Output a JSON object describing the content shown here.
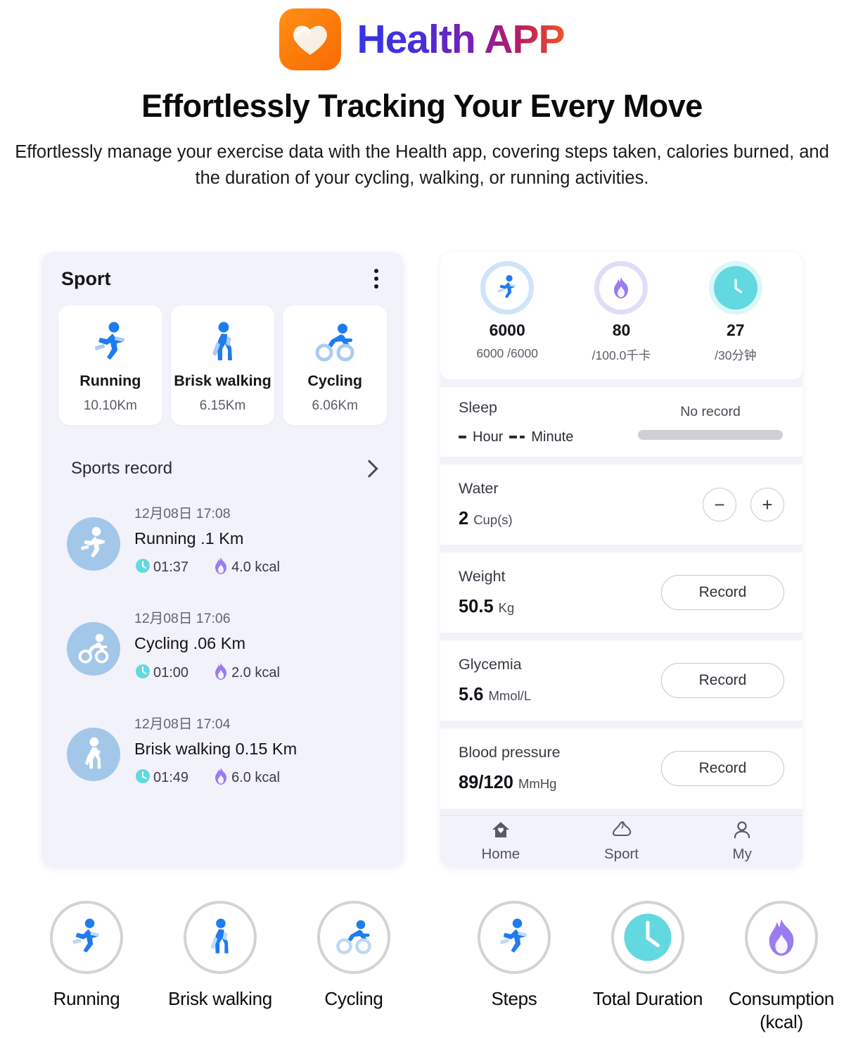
{
  "header": {
    "logo_icon": "heart-icon",
    "brand_name": "Health APP",
    "headline": "Effortlessly Tracking Your Every Move",
    "subheadline": "Effortlessly manage your exercise data with the Health app, covering steps taken, calories burned, and the duration of your cycling, walking, or running activities."
  },
  "colors": {
    "brand_orange": "#fb7a09",
    "brand_blue": "#3434e8",
    "brand_red": "#ef5422",
    "sport_blue": "#1f7ced",
    "avatar_blue": "#a3c7e8",
    "clock_cyan": "#62d9e0",
    "flame_purple": "#9b7cf0",
    "panel_bg": "#f2f2fa"
  },
  "sport_panel": {
    "title": "Sport",
    "menu_icon": "kebab-menu-icon",
    "cards": [
      {
        "icon": "running-icon",
        "name": "Running",
        "distance": "10.10Km"
      },
      {
        "icon": "walking-icon",
        "name": "Brisk walking",
        "distance": "6.15Km"
      },
      {
        "icon": "cycling-icon",
        "name": "Cycling",
        "distance": "6.06Km"
      }
    ],
    "record_section": {
      "label": "Sports record",
      "chevron_icon": "chevron-right-icon"
    },
    "records": [
      {
        "icon": "running-icon",
        "date": "12月08日 17:08",
        "activity": "Running   .1 Km",
        "duration": "01:37",
        "calories": "4.0 kcal"
      },
      {
        "icon": "cycling-icon",
        "date": "12月08日 17:06",
        "activity": "Cycling   .06 Km",
        "duration": "01:00",
        "calories": "2.0 kcal"
      },
      {
        "icon": "walking-icon",
        "date": "12月08日 17:04",
        "activity": "Brisk walking 0.15 Km",
        "duration": "01:49",
        "calories": "6.0 kcal"
      }
    ]
  },
  "home_panel": {
    "top_stats": [
      {
        "icon": "running-icon",
        "value": "6000",
        "sub": "6000 /6000"
      },
      {
        "icon": "flame-icon",
        "value": "80",
        "sub": "/100.0千卡"
      },
      {
        "icon": "clock-icon",
        "value": "27",
        "sub": "/30分钟"
      }
    ],
    "sleep": {
      "label": "Sleep",
      "hour_unit": "Hour",
      "minute_unit": "Minute",
      "status": "No record"
    },
    "water": {
      "label": "Water",
      "value": "2",
      "unit": "Cup(s)",
      "minus_label": "−",
      "plus_label": "+"
    },
    "weight": {
      "label": "Weight",
      "value": "50.5",
      "unit": "Kg",
      "button": "Record"
    },
    "glycemia": {
      "label": "Glycemia",
      "value": "5.6",
      "unit": "Mmol/L",
      "button": "Record"
    },
    "blood_pressure": {
      "label": "Blood pressure",
      "value": "89/120",
      "unit": "MmHg",
      "button": "Record"
    },
    "tabs": [
      {
        "icon": "home-icon",
        "label": "Home"
      },
      {
        "icon": "shoe-icon",
        "label": "Sport"
      },
      {
        "icon": "person-icon",
        "label": "My"
      }
    ]
  },
  "feature_strip": [
    {
      "icon": "running-icon",
      "label": "Running"
    },
    {
      "icon": "walking-icon",
      "label": "Brisk walking"
    },
    {
      "icon": "cycling-icon",
      "label": "Cycling"
    },
    {
      "icon": "running-icon",
      "label": "Steps"
    },
    {
      "icon": "clock-icon",
      "label": "Total Duration"
    },
    {
      "icon": "flame-icon",
      "label": "Consumption (kcal)"
    }
  ]
}
